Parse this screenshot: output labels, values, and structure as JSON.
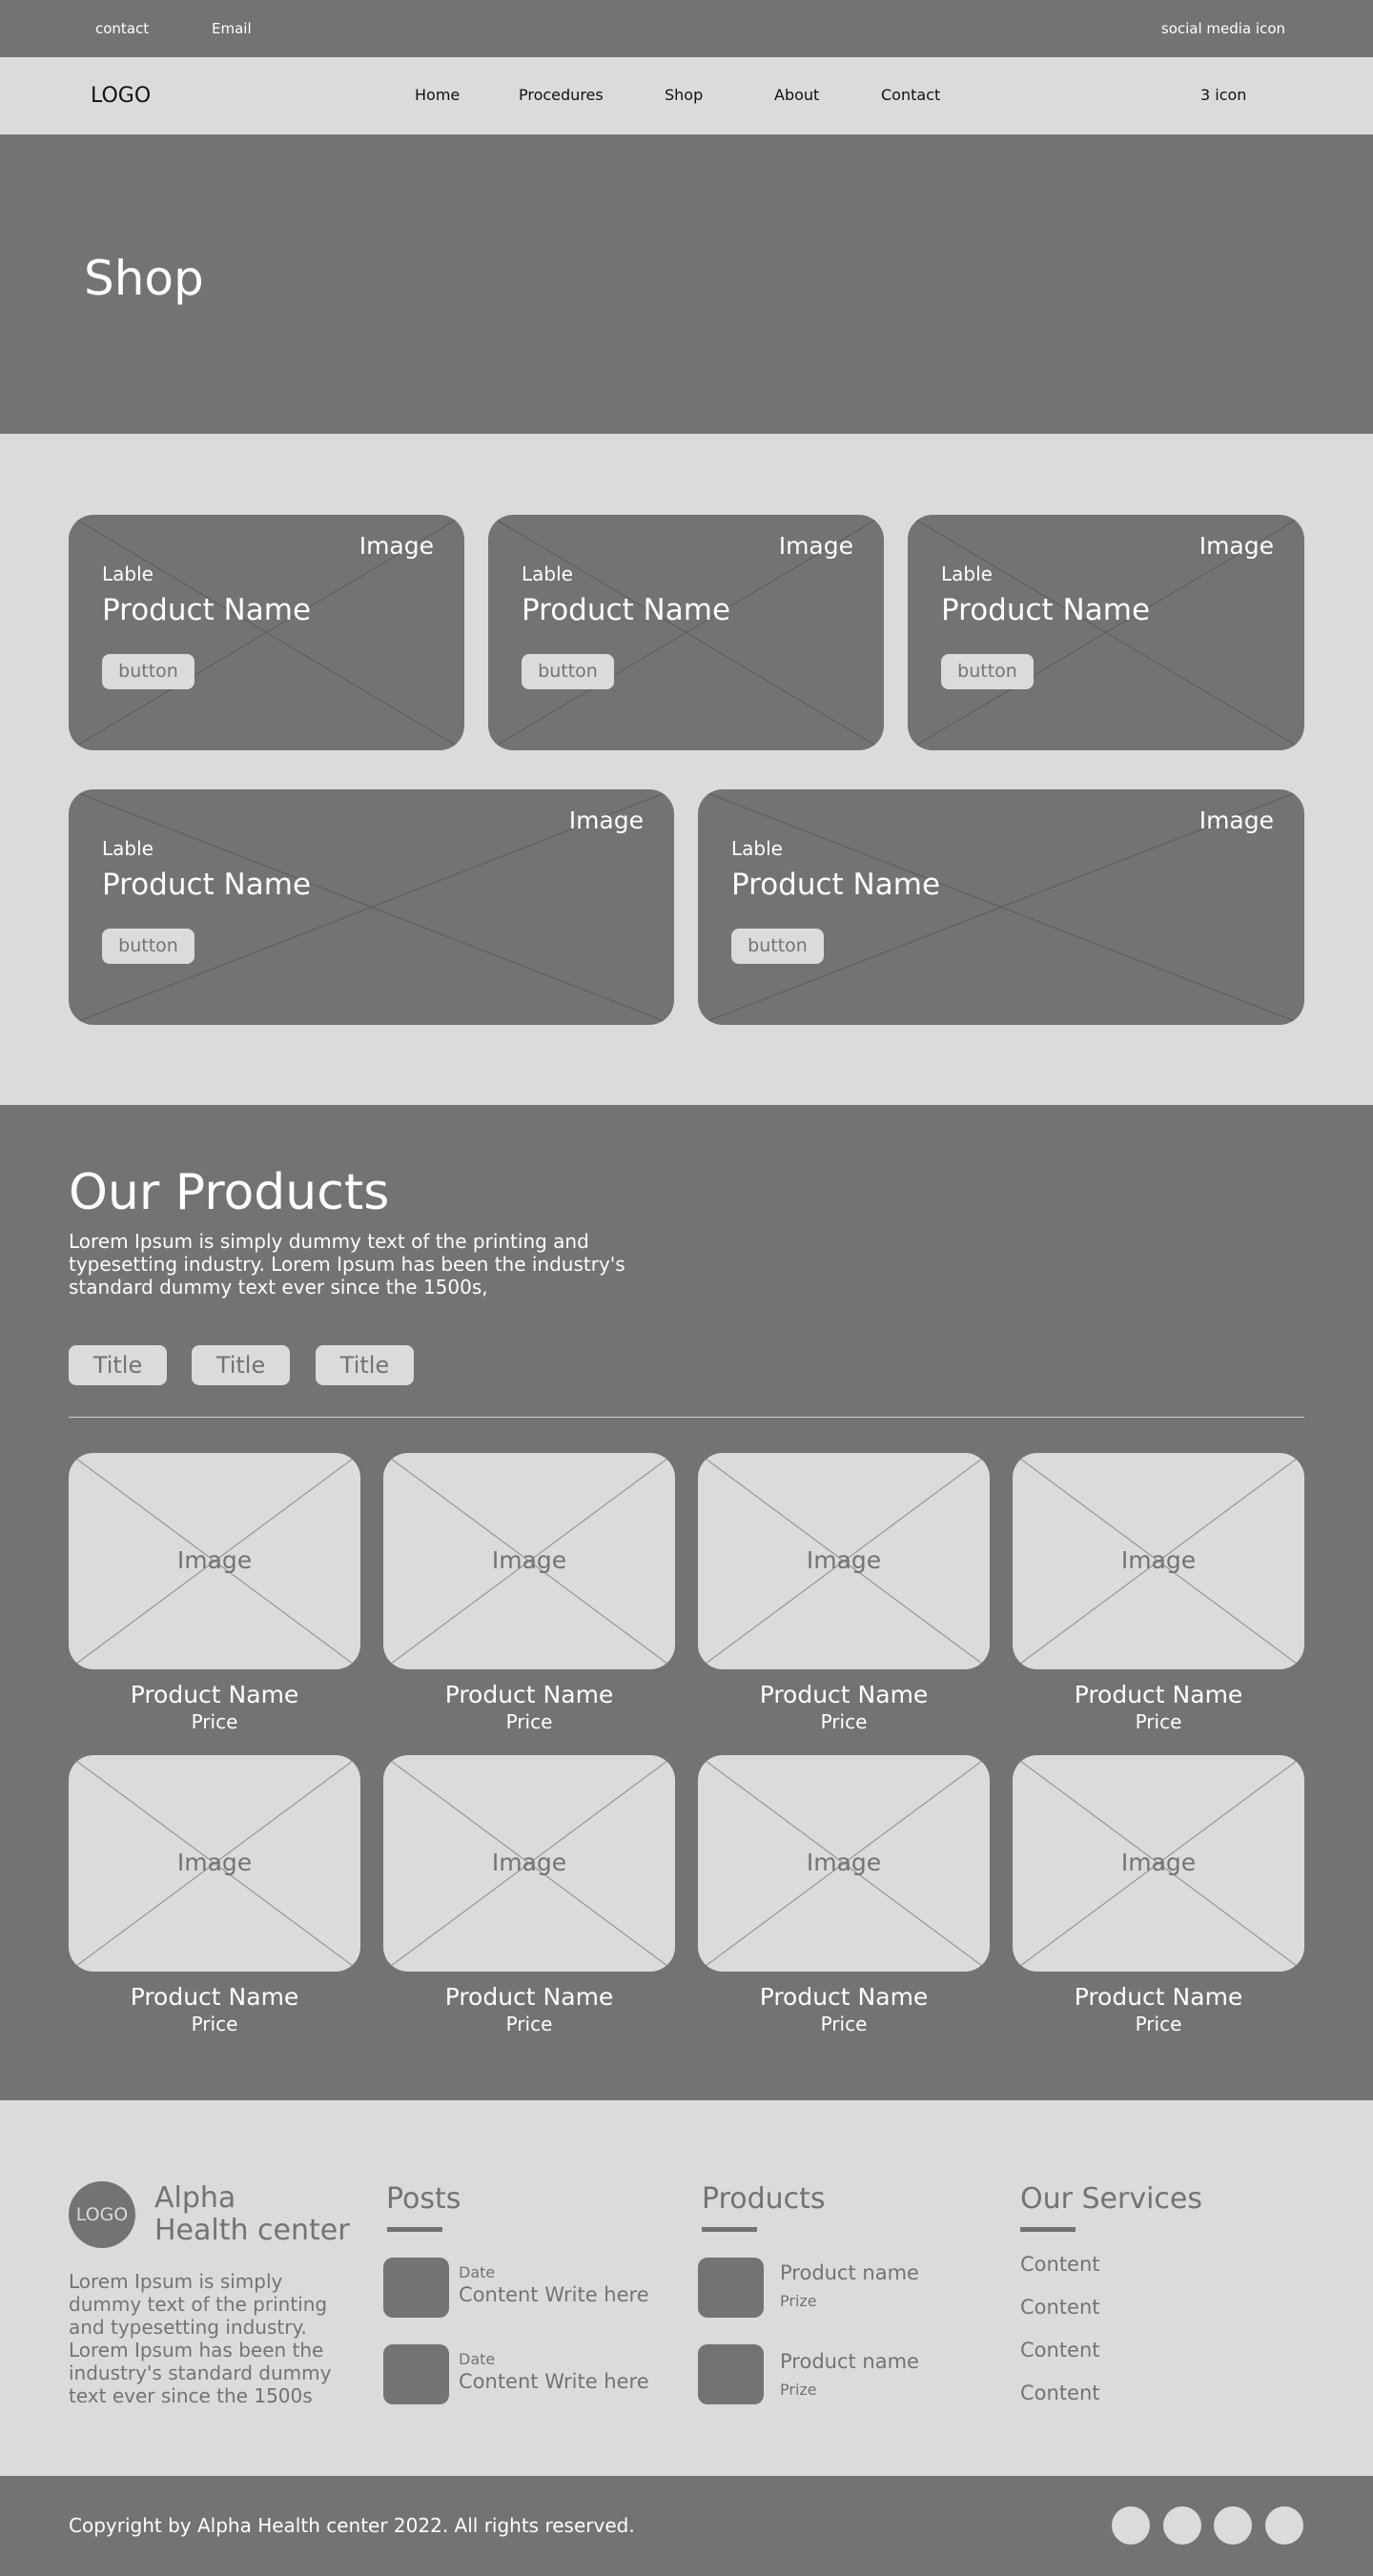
{
  "topbar": {
    "contact": "contact",
    "email": "Email",
    "social": "social media icon"
  },
  "nav": {
    "logo": "LOGO",
    "items": [
      "Home",
      "Procedures",
      "Shop",
      "About",
      "Contact"
    ],
    "icons": "3 icon"
  },
  "hero": {
    "title": "Shop"
  },
  "features": {
    "cards": [
      {
        "image": "Image",
        "label": "Lable",
        "name": "Product Name",
        "button": "button"
      },
      {
        "image": "Image",
        "label": "Lable",
        "name": "Product Name",
        "button": "button"
      },
      {
        "image": "Image",
        "label": "Lable",
        "name": "Product Name",
        "button": "button"
      },
      {
        "image": "Image",
        "label": "Lable",
        "name": "Product Name",
        "button": "button"
      },
      {
        "image": "Image",
        "label": "Lable",
        "name": "Product Name",
        "button": "button"
      }
    ]
  },
  "products": {
    "title": "Our Products",
    "description": "Lorem Ipsum is simply dummy text of the printing and typesetting industry. Lorem Ipsum has been the industry's standard dummy text ever since the 1500s,",
    "tabs": [
      "Title",
      "Title",
      "Title"
    ],
    "items": [
      {
        "image": "Image",
        "name": "Product Name",
        "price": "Price"
      },
      {
        "image": "Image",
        "name": "Product Name",
        "price": "Price"
      },
      {
        "image": "Image",
        "name": "Product Name",
        "price": "Price"
      },
      {
        "image": "Image",
        "name": "Product Name",
        "price": "Price"
      },
      {
        "image": "Image",
        "name": "Product Name",
        "price": "Price"
      },
      {
        "image": "Image",
        "name": "Product Name",
        "price": "Price"
      },
      {
        "image": "Image",
        "name": "Product Name",
        "price": "Price"
      },
      {
        "image": "Image",
        "name": "Product Name",
        "price": "Price"
      }
    ]
  },
  "footer": {
    "logo": "LOGO",
    "brand_line1": "Alpha",
    "brand_line2": "Health center",
    "about": "Lorem Ipsum is simply dummy text of the printing and typesetting industry. Lorem Ipsum has been the industry's standard dummy text ever since the 1500s",
    "posts": {
      "heading": "Posts",
      "items": [
        {
          "date": "Date",
          "content": "Content Write here"
        },
        {
          "date": "Date",
          "content": "Content Write here"
        }
      ]
    },
    "products": {
      "heading": "Products",
      "items": [
        {
          "name": "Product name",
          "prize": "Prize"
        },
        {
          "name": "Product name",
          "prize": "Prize"
        }
      ]
    },
    "services": {
      "heading": "Our Services",
      "items": [
        "Content",
        "Content",
        "Content",
        "Content"
      ]
    }
  },
  "bottombar": {
    "copyright": "Copyright by Alpha Health center 2022. All rights reserved."
  },
  "colors": {
    "dark_gray": "#737373",
    "light_gray": "#dbdbdb",
    "white": "#ffffff"
  }
}
